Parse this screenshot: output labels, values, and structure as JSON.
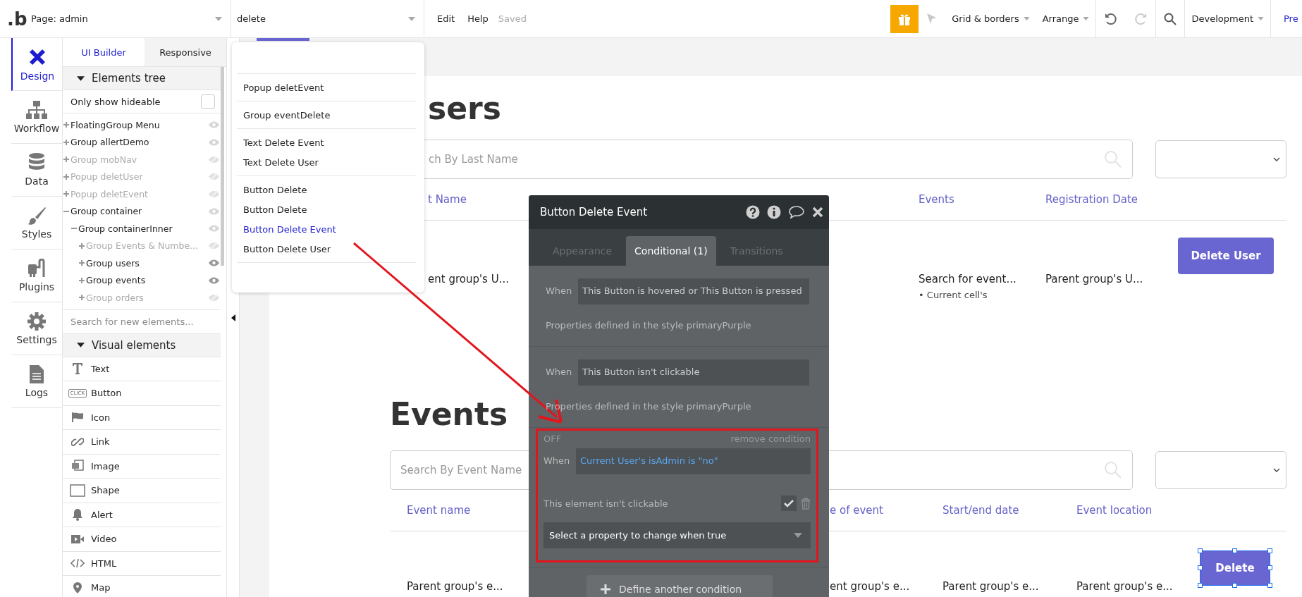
{
  "top_bar": {
    "logo": ".b",
    "page_selector": "Page: admin",
    "element_search": "delete",
    "menu": [
      "Edit",
      "Help"
    ],
    "save_status": "Saved",
    "grid_menu": "Grid & borders",
    "arrange_menu": "Arrange",
    "environment": "Development",
    "preview_link": "Pre"
  },
  "side_tabs": [
    {
      "label": "Design",
      "kind": "design",
      "selected": true
    },
    {
      "label": "Workflow",
      "kind": "workflow",
      "selected": false
    },
    {
      "label": "Data",
      "kind": "data",
      "selected": false
    },
    {
      "label": "Styles",
      "kind": "styles",
      "selected": false
    },
    {
      "label": "Plugins",
      "kind": "plugins",
      "selected": false
    },
    {
      "label": "Settings",
      "kind": "settings",
      "selected": false
    },
    {
      "label": "Logs",
      "kind": "logs",
      "selected": false
    }
  ],
  "panel": {
    "tabs": [
      {
        "label": "UI Builder",
        "selected": true
      },
      {
        "label": "Responsive",
        "selected": false
      }
    ],
    "tree_header": "Elements tree",
    "hideable_filter": {
      "label": "Only show hideable",
      "checked": false
    },
    "tree": [
      {
        "label": "FloatingGroup Menu",
        "expanded": false,
        "visible": true
      },
      {
        "label": "Group allertDemo",
        "expanded": false,
        "visible": true
      },
      {
        "label": "Group mobNav",
        "expanded": false,
        "visible": false
      },
      {
        "label": "Popup deletUser",
        "expanded": false,
        "visible": false
      },
      {
        "label": "Popup deletEvent",
        "expanded": false,
        "visible": false
      },
      {
        "label": "Group container",
        "expanded": true,
        "visible": true,
        "children": [
          {
            "label": "Group containerInner",
            "expanded": true,
            "visible": true,
            "children": [
              {
                "label": "Group Events & Numbe...",
                "expanded": false,
                "visible": false
              },
              {
                "label": "Group users",
                "expanded": false,
                "visible": true
              },
              {
                "label": "Group events",
                "expanded": false,
                "visible": true
              },
              {
                "label": "Group orders",
                "expanded": false,
                "visible": false
              }
            ]
          }
        ]
      }
    ],
    "search": {
      "placeholder": "Search for new elements..."
    },
    "palette_header": "Visual elements",
    "palette": [
      {
        "label": "Text",
        "kind": "text"
      },
      {
        "label": "Button",
        "kind": "button",
        "icon_text": "CLICK"
      },
      {
        "label": "Icon",
        "kind": "icon"
      },
      {
        "label": "Link",
        "kind": "link"
      },
      {
        "label": "Image",
        "kind": "image"
      },
      {
        "label": "Shape",
        "kind": "shape"
      },
      {
        "label": "Alert",
        "kind": "alert"
      },
      {
        "label": "Video",
        "kind": "video"
      },
      {
        "label": "HTML",
        "kind": "html"
      },
      {
        "label": "Map",
        "kind": "map"
      }
    ]
  },
  "search_results": [
    {
      "items": [
        {
          "label": "Popup deletEvent",
          "selected": false
        }
      ]
    },
    {
      "items": [
        {
          "label": "Group eventDelete",
          "selected": false
        }
      ]
    },
    {
      "items": [
        {
          "label": "Text Delete Event",
          "selected": false
        },
        {
          "label": "Text Delete User",
          "selected": false
        }
      ]
    },
    {
      "items": [
        {
          "label": "Button Delete",
          "selected": false
        },
        {
          "label": "Button Delete",
          "selected": false
        },
        {
          "label": "Button Delete Event",
          "selected": true
        },
        {
          "label": "Button Delete User",
          "selected": false
        }
      ]
    }
  ],
  "users": {
    "heading": "sers",
    "search": {
      "placeholder": "ch By Last Name"
    },
    "columns": [
      "t Name",
      "Events",
      "Registration Date"
    ],
    "rows": [
      {
        "cells": [
          "ent group's U...",
          "Search for event...",
          "Parent group's U..."
        ],
        "note": "• Current cell's",
        "button": "Delete User",
        "selected": false
      }
    ]
  },
  "events": {
    "heading": "Events",
    "search": {
      "placeholder": "Search By Event Name"
    },
    "columns": [
      "Event name",
      "e of event",
      "Start/end date",
      "Event location"
    ],
    "rows": [
      {
        "cells": [
          "Parent group's e...",
          "ent group's e...",
          "Parent group's e...",
          "Parent group's e..."
        ],
        "button": "Delete",
        "selected": true
      }
    ]
  },
  "inspector": {
    "title": "Button Delete Event",
    "tabs": [
      {
        "label": "Appearance",
        "selected": false
      },
      {
        "label": "Conditional (1)",
        "selected": true
      },
      {
        "label": "Transitions",
        "selected": false
      }
    ],
    "conditions": [
      {
        "kind": "style",
        "when_label": "When",
        "when": "This Button is hovered or This Button is pressed",
        "note": "Properties defined in the style primaryPurple"
      },
      {
        "kind": "style",
        "when_label": "When",
        "when": "This Button isn't clickable",
        "note": "Properties defined in the style primaryPurple"
      },
      {
        "kind": "custom",
        "highlighted": true,
        "status": "OFF",
        "remove": "remove condition",
        "when_label": "When",
        "when": "Current User's isAdmin is \"no\"",
        "property": {
          "label": "This element isn't clickable",
          "checked": true
        },
        "select": "Select a property to change when true"
      }
    ],
    "add_button": "Define another condition"
  }
}
